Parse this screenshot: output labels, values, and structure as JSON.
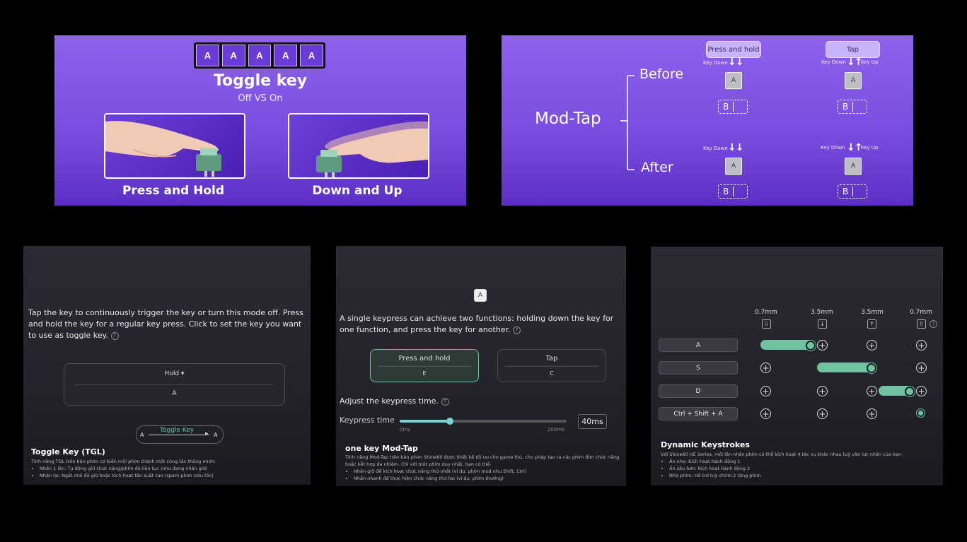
{
  "toggle_slide": {
    "keys": [
      "A",
      "A",
      "A",
      "A",
      "A"
    ],
    "title": "Toggle key",
    "subtitle": "Off VS On",
    "left_caption": "Press and Hold",
    "right_caption": "Down and Up"
  },
  "modtap_slide": {
    "title": "Mod-Tap",
    "before": "Before",
    "after": "After",
    "press_hold_label": "Press and hold",
    "tap_label": "Tap",
    "key_down": "Key Down",
    "key_up": "Key Up",
    "key_a": "A",
    "key_b": "B"
  },
  "tgl_panel": {
    "description": "Tap the key to continuously trigger the key or turn this mode off. Press and hold the key for a regular key press. Click to set the key you want to use as toggle key.",
    "help": "?",
    "mode_select": "Hold",
    "mode_caret": "▾",
    "key_value": "A",
    "diagram_label": "Toggle Key",
    "diagram_left": "A",
    "diagram_right": "A",
    "section_title": "Toggle Key (TGL)",
    "section_intro": "Tính năng TGL trên bàn phím cơ biến mỗi phím thành một công tắc thông minh:",
    "bullets": [
      "Nhấn 1 lần: Tự động giữ chức năng/phím đó liên tục (như đang nhấn giữ)",
      "Nhấn lại: Ngắt chế độ giữ hoặc kích hoạt tần suất cao (spam phím siêu tốc)"
    ]
  },
  "modtap_panel": {
    "key_icon": "A",
    "description": "A single keypress can achieve two functions: holding down the key for one function, and press the key for another.",
    "help": "?",
    "press_hold_title": "Press and hold",
    "press_hold_value": "E",
    "tap_title": "Tap",
    "tap_value": "C",
    "adjust_label": "Adjust the keypress time.",
    "keypress_label": "Keypress time",
    "slider_min": "0ms",
    "slider_max": "200ms",
    "slider_fraction": 0.3,
    "keypress_value": "40ms",
    "section_title": "one key Mod-Tap",
    "section_intro": "Tính năng Mod-Tap trên bàn phím Shine60 được thiết kế tối ưu cho game thủ, cho phép tạo ra các phím đơn chức năng hoặc kết hợp đa nhiệm. Chỉ với một phím duy nhất, bạn có thể:",
    "bullets": [
      "Nhấn giữ để kích hoạt chức năng thứ nhất (ví dụ: phím mod như Shift, Ctrl)",
      "Nhấn nhanh để thực hiện chức năng thứ hai (ví dụ: phím thường)"
    ]
  },
  "dks_panel": {
    "columns": [
      "0.7mm",
      "3.5mm",
      "3.5mm",
      "0.7mm"
    ],
    "column_icons": [
      "⇩",
      "↓",
      "↑",
      "⇧"
    ],
    "help": "?",
    "rows": [
      "A",
      "S",
      "D",
      "Ctrl + Shift + A"
    ],
    "section_title": "Dynamic Keystrokes",
    "section_intro": "Với Shine60 HE Series, mỗi lần nhấn phím có thể kích hoạt 4 tác vụ khác nhau tuỳ vào lực nhấn của bạn:",
    "bullets": [
      "Ấn nhẹ: Kích hoạt hành động 1",
      "Ấn sâu hơn: Kích hoạt hành động 2",
      "Nhả phím: Hỗ trợ tuỳ chỉnh 2 tầng phím"
    ],
    "accent": "#6fc3a0"
  }
}
